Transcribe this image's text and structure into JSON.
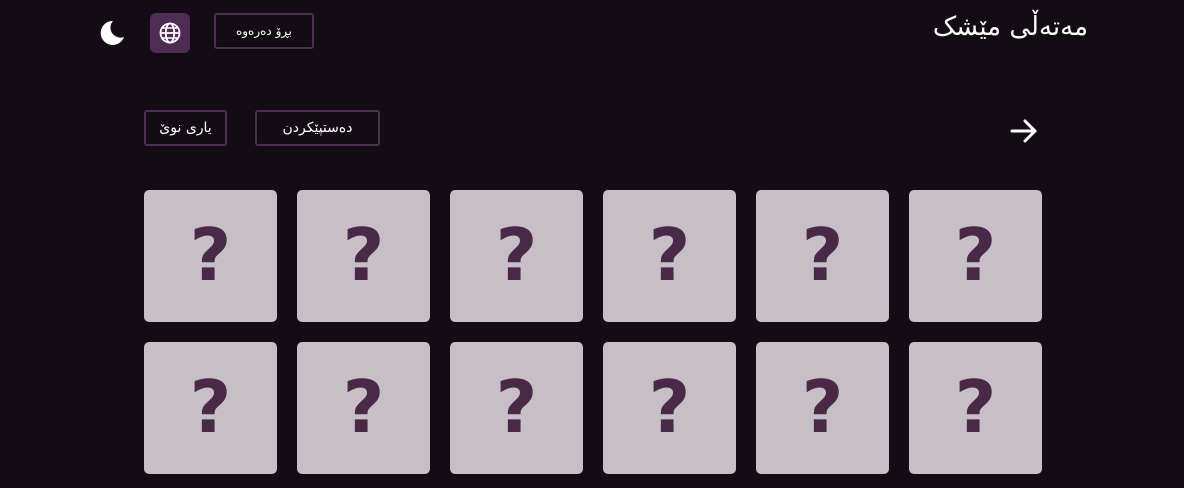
{
  "header": {
    "title": "مەتەڵی مێشک",
    "theme_icon": "moon-icon",
    "language_icon": "globe-icon",
    "exit_label": "بڕۆ دەرەوە"
  },
  "controls": {
    "new_game_label": "یاری نوێ",
    "start_label": "دەستپێکردن",
    "back_icon": "arrow-right-icon"
  },
  "board": {
    "cards": [
      {
        "face": "?"
      },
      {
        "face": "?"
      },
      {
        "face": "?"
      },
      {
        "face": "?"
      },
      {
        "face": "?"
      },
      {
        "face": "?"
      },
      {
        "face": "?"
      },
      {
        "face": "?"
      },
      {
        "face": "?"
      },
      {
        "face": "?"
      },
      {
        "face": "?"
      },
      {
        "face": "?"
      }
    ]
  },
  "colors": {
    "background": "#130c14",
    "accent": "#4e2d55",
    "card": "#c6c0c6",
    "card_mark": "#4a2848"
  }
}
